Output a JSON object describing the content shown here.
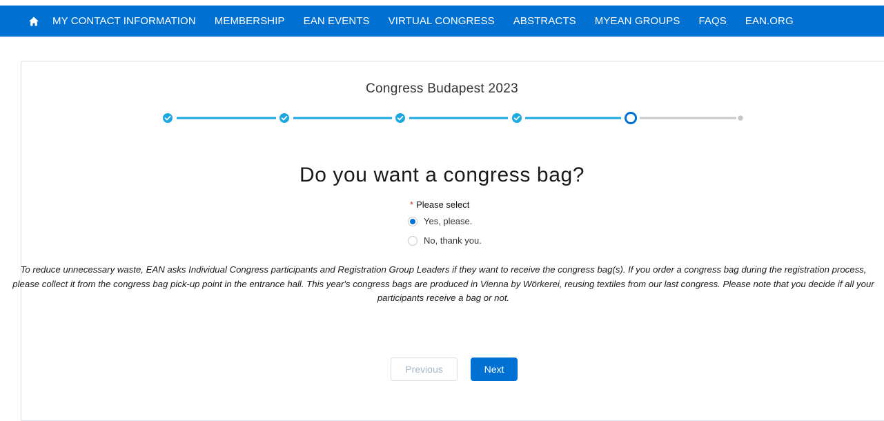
{
  "nav": {
    "home_icon": "home-icon",
    "items": [
      {
        "label": "MY CONTACT INFORMATION"
      },
      {
        "label": "MEMBERSHIP"
      },
      {
        "label": "EAN EVENTS"
      },
      {
        "label": "VIRTUAL CONGRESS"
      },
      {
        "label": "ABSTRACTS"
      },
      {
        "label": "MYEAN GROUPS"
      },
      {
        "label": "FAQS"
      },
      {
        "label": "EAN.ORG"
      }
    ]
  },
  "event": {
    "title": "Congress Budapest 2023"
  },
  "progress": {
    "total_steps": 6,
    "completed_steps": 4,
    "current_step": 5
  },
  "form": {
    "question": "Do you want a congress bag?",
    "required_marker": "*",
    "field_label": "Please select",
    "options": [
      {
        "label": "Yes, please.",
        "selected": true
      },
      {
        "label": "No, thank you.",
        "selected": false
      }
    ],
    "info_text": "To reduce unnecessary waste, EAN asks Individual Congress participants and Registration Group Leaders if they want to receive the congress bag(s). If you order a congress bag during the registration process, please collect it from the congress bag pick-up point in the entrance hall. This year's congress bags are produced in Vienna by Wörkerei, reusing textiles from our last congress. Please note that you decide if all your participants receive a bag or not."
  },
  "buttons": {
    "previous_label": "Previous",
    "next_label": "Next"
  },
  "colors": {
    "brand": "#0070d2",
    "progress_done": "#1ba9e1",
    "progress_todo": "#c9c9c9"
  }
}
